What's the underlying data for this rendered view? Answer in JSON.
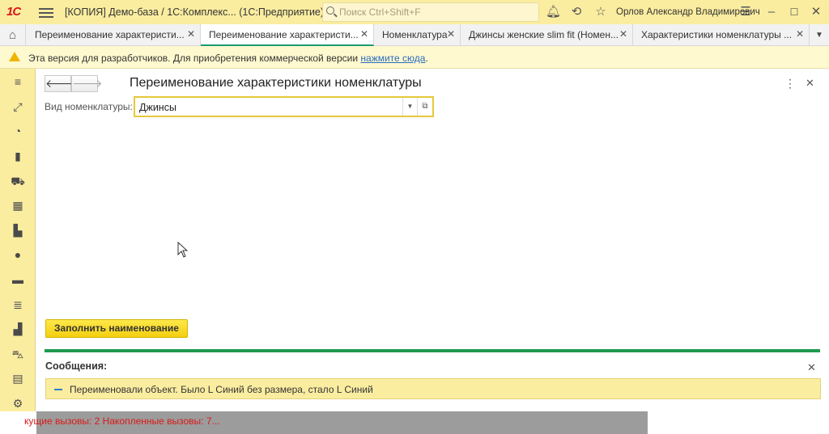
{
  "titlebar": {
    "logo": "1С",
    "title": "[КОПИЯ] Демо-база / 1С:Комплекс...   (1С:Предприятие)",
    "search_placeholder": "Поиск Ctrl+Shift+F",
    "user": "Орлов Александр Владимирович"
  },
  "tabs": [
    {
      "label": "Переименование характеристи..."
    },
    {
      "label": "Переименование характеристи..."
    },
    {
      "label": "Номенклатура"
    },
    {
      "label": "Джинсы женские slim fit (Номен..."
    },
    {
      "label": "Характеристики номенклатуры ..."
    }
  ],
  "banner": {
    "text": "Эта версия для разработчиков. Для приобретения коммерческой версии",
    "link": "нажмите сюда",
    "suffix": "."
  },
  "form": {
    "title": "Переименование характеристики номенклатуры",
    "field_label": "Вид номенклатуры:",
    "field_value": "Джинсы",
    "fill_button": "Заполнить наименование"
  },
  "messages": {
    "title": "Сообщения:",
    "items": [
      {
        "text": "Переименовали объект. Было L Синий без размера, стало L Синий"
      }
    ]
  },
  "status": {
    "text": "кущие вызовы: 2   Накопленные вызовы: 7..."
  },
  "colors": {
    "accent_yellow": "#fbeda0",
    "button_yellow": "#f3cf10",
    "progress_green": "#1f9a4f",
    "status_red": "#d91a1a"
  }
}
